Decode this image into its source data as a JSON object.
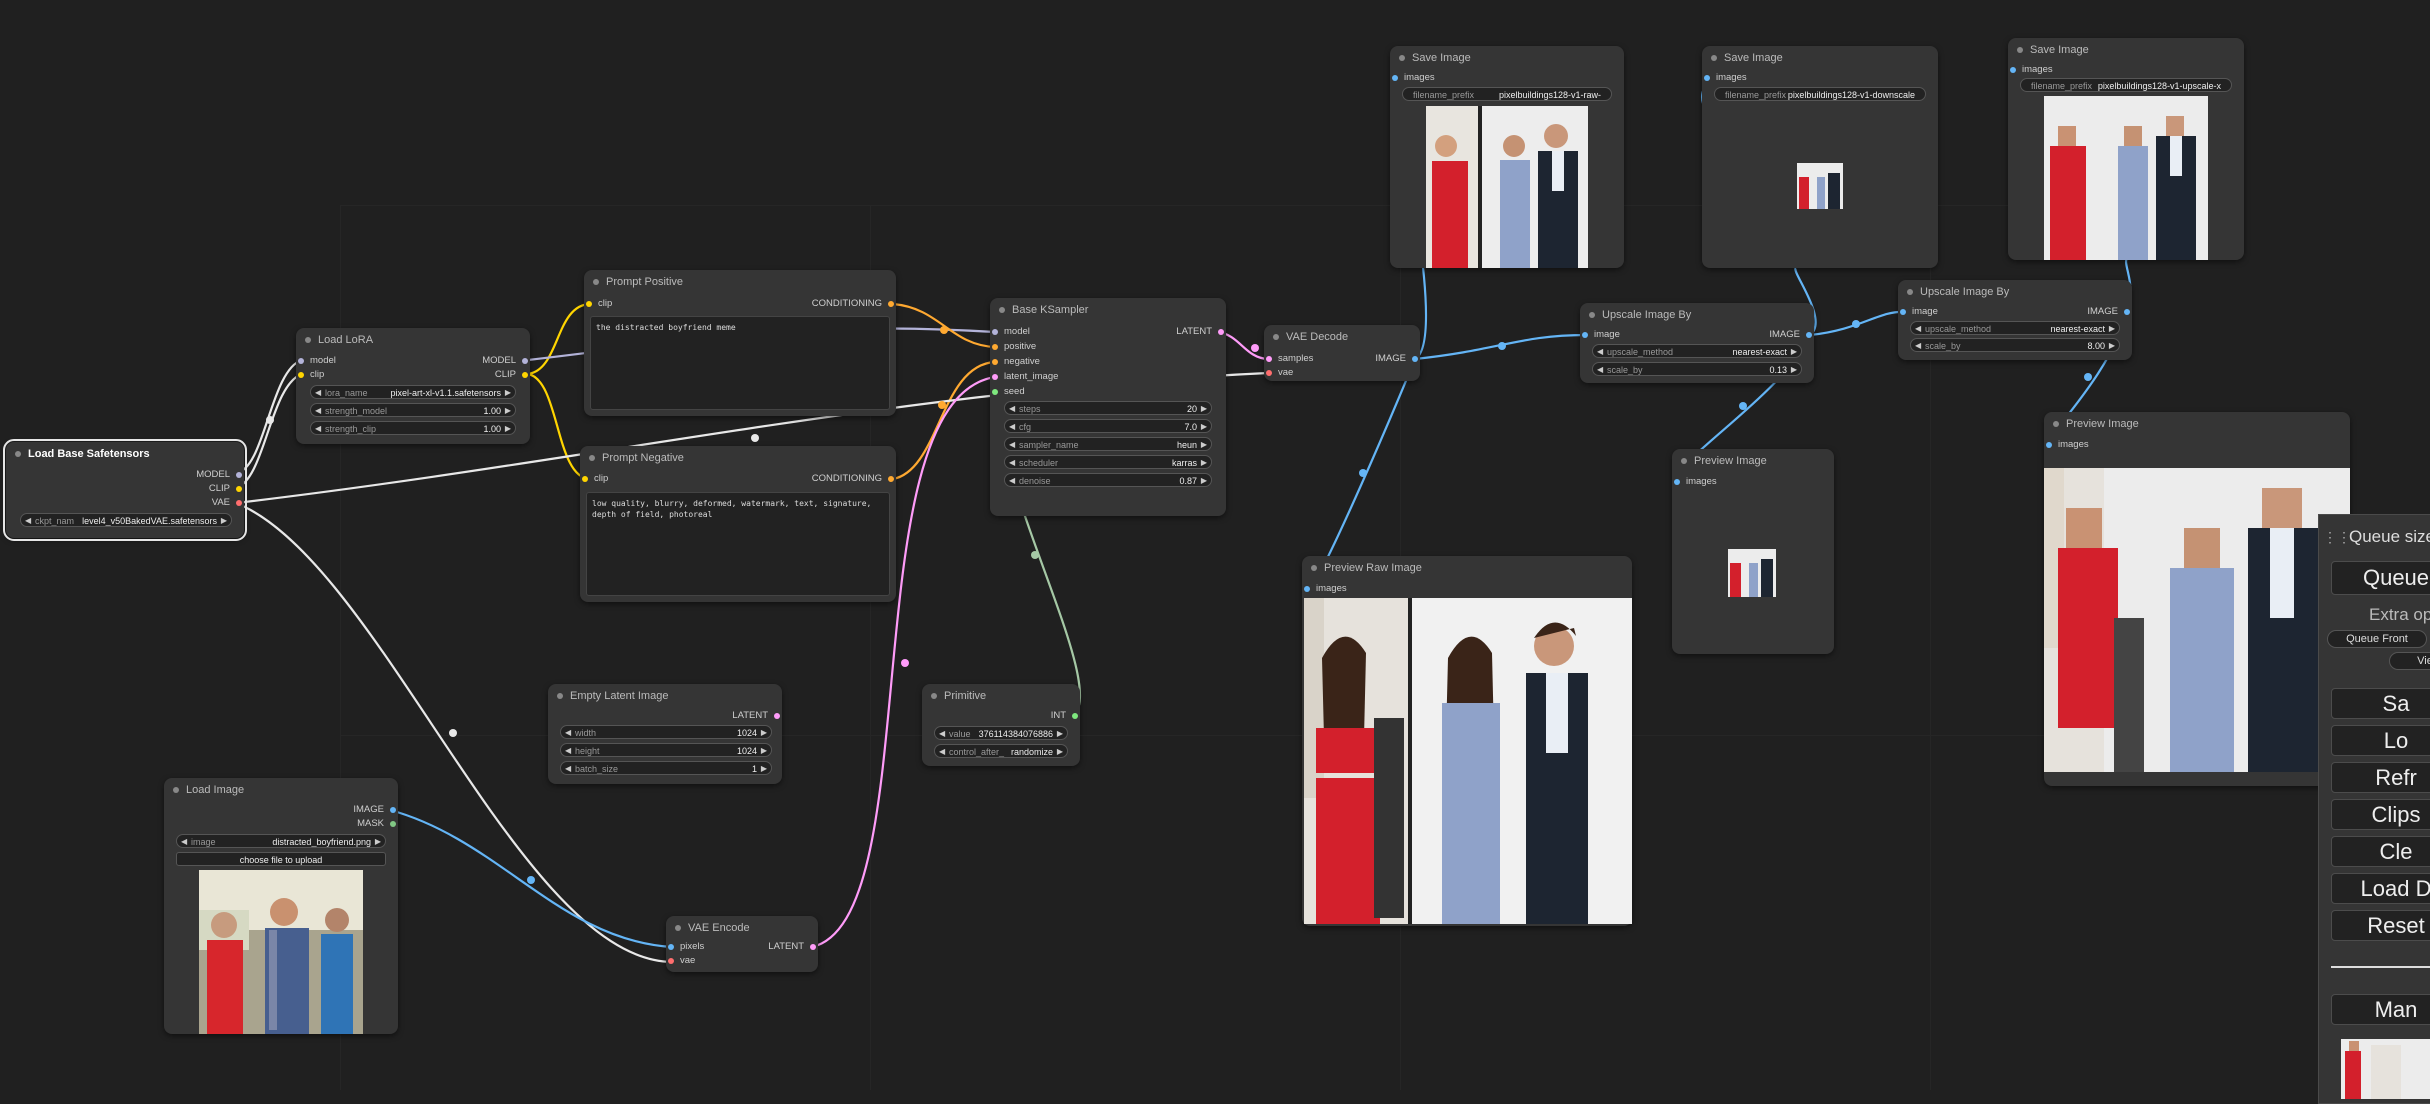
{
  "colors": {
    "background": "#202020",
    "node": "#353535",
    "model": "#b3b3d9",
    "clip": "#ffd500",
    "vae": "#ff6e6e",
    "conditioning": "#ffa931",
    "latent": "#ff9cf9",
    "image": "#64b5f6",
    "int": "#7ee87e",
    "mask": "#81c784",
    "white_link": "#e8e8e8"
  },
  "nodes": {
    "load_base": {
      "title": "Load Base Safetensors",
      "outputs": [
        "MODEL",
        "CLIP",
        "VAE"
      ],
      "ckpt_label": "ckpt_nam",
      "ckpt_value": "level4_v50BakedVAE.safetensors"
    },
    "load_lora": {
      "title": "Load LoRA",
      "inputs": [
        "model",
        "clip"
      ],
      "outputs": [
        "MODEL",
        "CLIP"
      ],
      "widgets": [
        {
          "label": "lora_name",
          "value": "pixel-art-xl-v1.1.safetensors"
        },
        {
          "label": "strength_model",
          "value": "1.00"
        },
        {
          "label": "strength_clip",
          "value": "1.00"
        }
      ]
    },
    "prompt_positive": {
      "title": "Prompt Positive",
      "input": "clip",
      "output": "CONDITIONING",
      "text": "the distracted boyfriend meme"
    },
    "prompt_negative": {
      "title": "Prompt Negative",
      "input": "clip",
      "output": "CONDITIONING",
      "text": "low quality, blurry, deformed, watermark, text, signature, depth of field, photoreal"
    },
    "ksampler": {
      "title": "Base KSampler",
      "inputs": [
        "model",
        "positive",
        "negative",
        "latent_image",
        "seed"
      ],
      "output": "LATENT",
      "widgets": [
        {
          "label": "steps",
          "value": "20"
        },
        {
          "label": "cfg",
          "value": "7.0"
        },
        {
          "label": "sampler_name",
          "value": "heun"
        },
        {
          "label": "scheduler",
          "value": "karras"
        },
        {
          "label": "denoise",
          "value": "0.87"
        }
      ]
    },
    "vae_decode": {
      "title": "VAE Decode",
      "inputs": [
        "samples",
        "vae"
      ],
      "output": "IMAGE"
    },
    "empty_latent": {
      "title": "Empty Latent Image",
      "output": "LATENT",
      "widgets": [
        {
          "label": "width",
          "value": "1024"
        },
        {
          "label": "height",
          "value": "1024"
        },
        {
          "label": "batch_size",
          "value": "1"
        }
      ]
    },
    "primitive": {
      "title": "Primitive",
      "output": "INT",
      "widgets": [
        {
          "label": "value",
          "value": "376114384076886"
        },
        {
          "label": "control_after_",
          "value": "randomize"
        }
      ]
    },
    "load_image": {
      "title": "Load Image",
      "outputs": [
        "IMAGE",
        "MASK"
      ],
      "image_label": "image",
      "image_value": "distracted_boyfriend.png",
      "upload_label": "choose file to upload"
    },
    "vae_encode": {
      "title": "VAE Encode",
      "inputs": [
        "pixels",
        "vae"
      ],
      "output": "LATENT"
    },
    "save1": {
      "title": "Save Image",
      "input": "images",
      "prefix_label": "filename_prefix",
      "prefix_value": "pixelbuildings128-v1-raw-"
    },
    "save2": {
      "title": "Save Image",
      "input": "images",
      "prefix_label": "filename_prefix",
      "prefix_value": "pixelbuildings128-v1-downscale"
    },
    "save3": {
      "title": "Save Image",
      "input": "images",
      "prefix_label": "filename_prefix",
      "prefix_value": "pixelbuildings128-v1-upscale-x"
    },
    "upscale1": {
      "title": "Upscale Image By",
      "input": "image",
      "output": "IMAGE",
      "widgets": [
        {
          "label": "upscale_method",
          "value": "nearest-exact"
        },
        {
          "label": "scale_by",
          "value": "0.13"
        }
      ]
    },
    "upscale2": {
      "title": "Upscale Image By",
      "input": "image",
      "output": "IMAGE",
      "widgets": [
        {
          "label": "upscale_method",
          "value": "nearest-exact"
        },
        {
          "label": "scale_by",
          "value": "8.00"
        }
      ]
    },
    "preview_small": {
      "title": "Preview Image",
      "input": "images"
    },
    "preview_raw": {
      "title": "Preview Raw Image",
      "input": "images"
    },
    "preview_big": {
      "title": "Preview Image",
      "input": "images"
    }
  },
  "panel": {
    "queue_size": "Queue size",
    "queue_prompt": "Queue",
    "extra_options": "Extra op",
    "queue_front": "Queue Front",
    "view": "View",
    "buttons": [
      "Sa",
      "Lo",
      "Refr",
      "Clips",
      "Cle",
      "Load D",
      "Reset"
    ],
    "manager": "Man"
  }
}
